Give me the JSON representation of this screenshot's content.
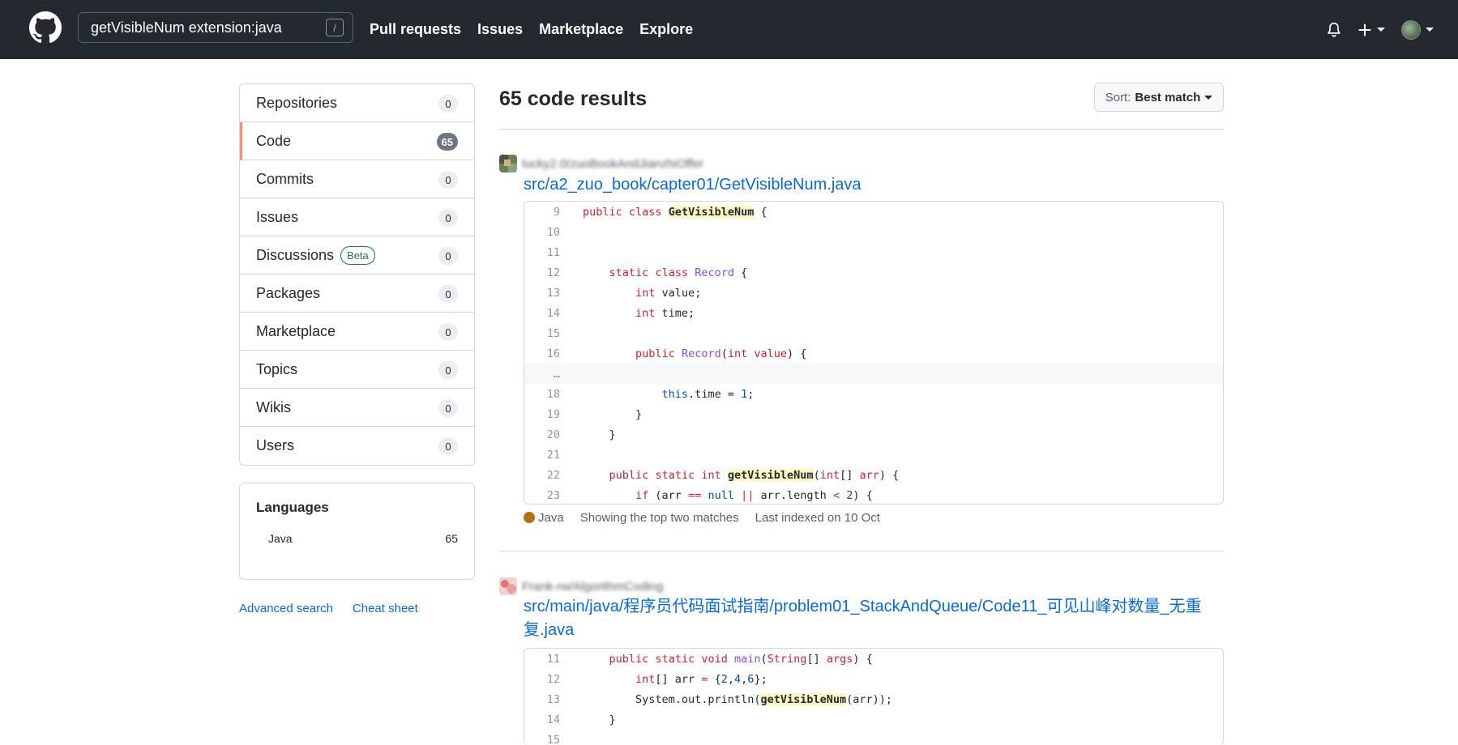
{
  "header": {
    "search_value": "getVisibleNum extension:java",
    "search_shortcut": "/",
    "nav": [
      "Pull requests",
      "Issues",
      "Marketplace",
      "Explore"
    ]
  },
  "sidebar": {
    "filters": [
      {
        "label": "Repositories",
        "count": "0"
      },
      {
        "label": "Code",
        "count": "65"
      },
      {
        "label": "Commits",
        "count": "0"
      },
      {
        "label": "Issues",
        "count": "0"
      },
      {
        "label": "Discussions",
        "badge": "Beta",
        "count": "0"
      },
      {
        "label": "Packages",
        "count": "0"
      },
      {
        "label": "Marketplace",
        "count": "0"
      },
      {
        "label": "Topics",
        "count": "0"
      },
      {
        "label": "Wikis",
        "count": "0"
      },
      {
        "label": "Users",
        "count": "0"
      }
    ],
    "languages_title": "Languages",
    "languages": [
      {
        "name": "Java",
        "count": "65"
      }
    ],
    "links": [
      "Advanced search",
      "Cheat sheet"
    ]
  },
  "main": {
    "results_title": "65 code results",
    "sort_prefix": "Sort:",
    "sort_value": "Best match",
    "results": [
      {
        "repo": "lucky2.0/zuoBookAndJianzhiOffer",
        "path": "src/a2_zuo_book/capter01/GetVisibleNum.java",
        "lines": [
          "9",
          "10",
          "11",
          "12",
          "13",
          "14",
          "15",
          "16",
          "…",
          "18",
          "19",
          "20",
          "21",
          "22",
          "23"
        ],
        "language": "Java",
        "matches_note": "Showing the top two matches",
        "indexed": "Last indexed on 10 Oct"
      },
      {
        "repo": "Frank-rw/AlgorithmCoding",
        "path": "src/main/java/程序员代码面试指南/problem01_StackAndQueue/Code11_可见山峰对数量_无重复.java",
        "lines": [
          "11",
          "12",
          "13",
          "14",
          "15"
        ]
      }
    ]
  },
  "colors": {
    "header_bg": "#24292f",
    "link": "#0969da",
    "selected_accent": "#fd8c73",
    "java": "#b07219",
    "highlight": "#fff8c5"
  },
  "icons": [
    "github-logo-icon",
    "bell-icon",
    "plus-icon",
    "caret-down-icon",
    "avatar"
  ]
}
